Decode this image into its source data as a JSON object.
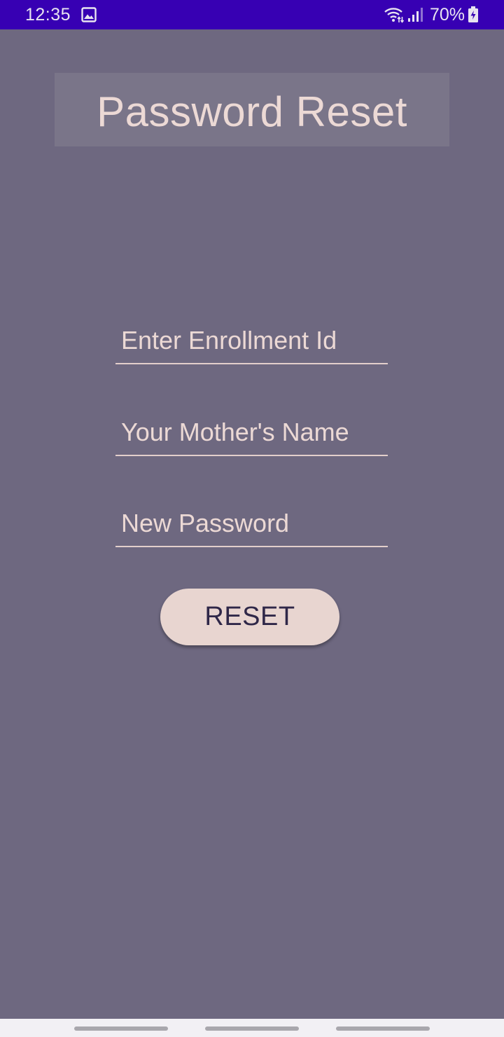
{
  "status_bar": {
    "time": "12:35",
    "battery": "70%",
    "icons": [
      "gallery-icon",
      "wifi-icon",
      "signal-icon",
      "battery-icon"
    ],
    "background_color": "#3700b3"
  },
  "header": {
    "title": "Password Reset"
  },
  "form": {
    "enrollment_placeholder": "Enter Enrollment Id",
    "mother_name_placeholder": "Your Mother's Name",
    "new_password_placeholder": "New Password",
    "reset_label": "RESET"
  },
  "nav_bar": {
    "items": [
      "back-gesture",
      "home-gesture",
      "recents-gesture"
    ]
  },
  "colors": {
    "background": "#6e6880",
    "title_box": "#7a7589",
    "text": "#ecd9d5",
    "button": "#e8d5d0",
    "button_text": "#2f2748"
  }
}
